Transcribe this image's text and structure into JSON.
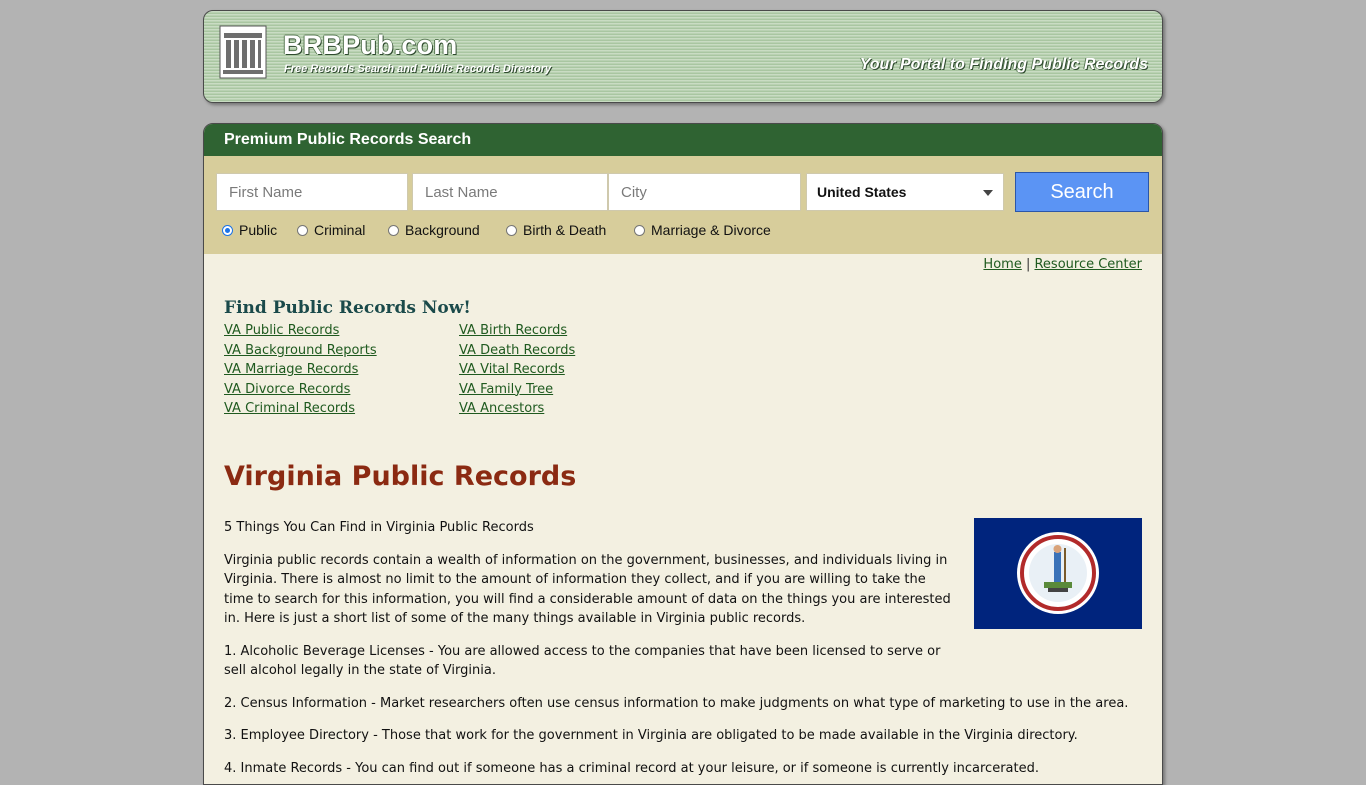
{
  "header": {
    "site_title": "BRBPub.com",
    "subtitle": "Free Records Search and Public Records Directory",
    "tagline": "Your Portal to Finding Public Records"
  },
  "search": {
    "title": "Premium Public Records Search",
    "first_name_placeholder": "First Name",
    "last_name_placeholder": "Last Name",
    "city_placeholder": "City",
    "country_selected": "United States",
    "button_label": "Search",
    "radio_options": [
      "Public",
      "Criminal",
      "Background",
      "Birth & Death",
      "Marriage & Divorce"
    ],
    "radio_selected": "Public"
  },
  "nav": {
    "home": "Home",
    "separator": "|",
    "resource_center": "Resource Center"
  },
  "find": {
    "title": "Find Public Records Now!",
    "col1": [
      "VA Public Records",
      "VA Background Reports",
      "VA Marriage Records",
      "VA Divorce Records",
      "VA Criminal Records"
    ],
    "col2": [
      "VA Birth Records",
      "VA Death Records",
      "VA Vital Records",
      "VA Family Tree",
      "VA Ancestors"
    ]
  },
  "article": {
    "title": "Virginia Public Records",
    "intro_heading": "5 Things You Can Find in Virginia Public Records",
    "p1": "Virginia public records contain a wealth of information on the government, businesses, and individuals living in Virginia. There is almost no limit to the amount of information they collect, and if you are willing to take the time to search for this information, you will find a considerable amount of data on the things you are interested in. Here is just a short list of some of the many things available in Virginia public records.",
    "p2": "1. Alcoholic Beverage Licenses - You are allowed access to the companies that have been licensed to serve or sell alcohol legally in the state of Virginia.",
    "p3": "2. Census Information - Market researchers often use census information to make judgments on what type of marketing to use in the area.",
    "p4": "3. Employee Directory - Those that work for the government in Virginia are obligated to be made available in the Virginia directory.",
    "p5": "4. Inmate Records - You can find out if someone has a criminal record at your leisure, or if someone is currently incarcerated."
  },
  "colors": {
    "header_green": "#2f6332",
    "search_panel": "#d7cd9b",
    "page_bg": "#f3f0e1",
    "title_red": "#8b2a12",
    "flag_blue": "#00247d",
    "button_blue": "#5b94f4"
  }
}
